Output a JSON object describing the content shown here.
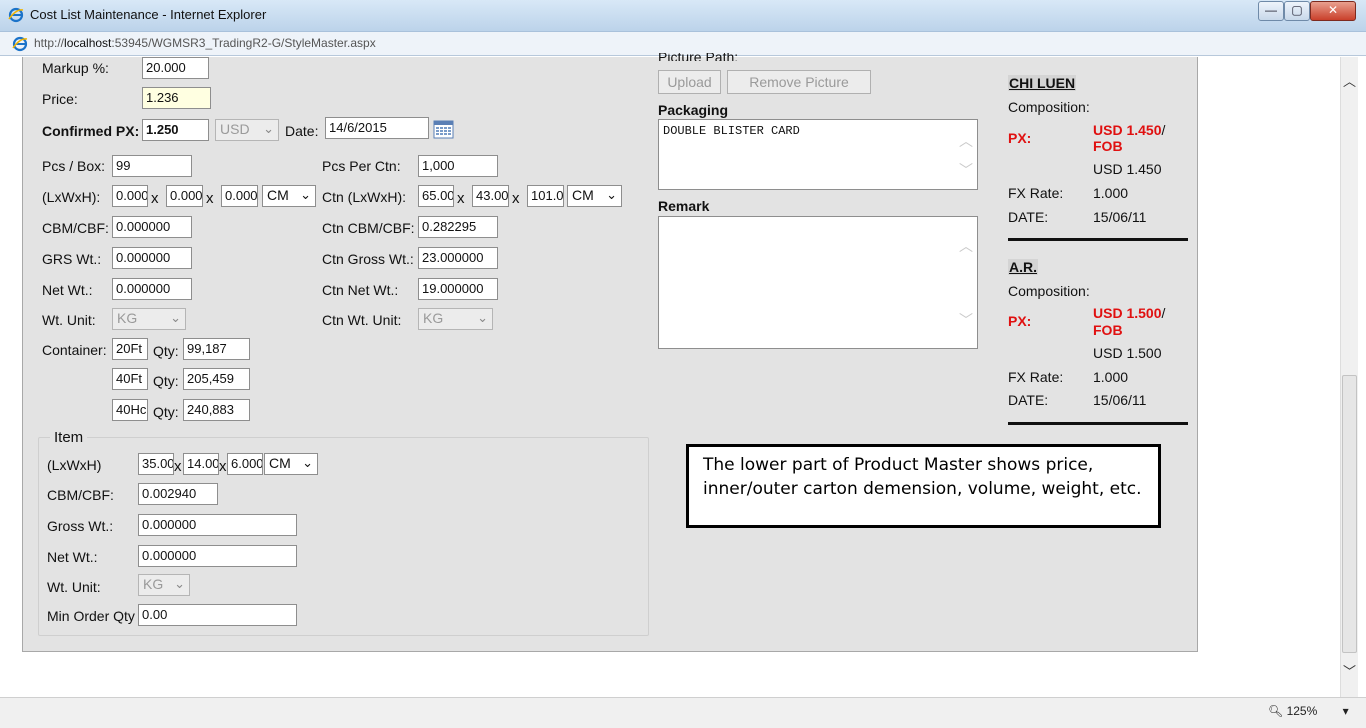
{
  "window": {
    "title": "Cost List Maintenance - Internet Explorer",
    "url_prefix": "http://",
    "url_host": "localhost",
    "url_rest": ":53945/WGMSR3_TradingR2-G/StyleMaster.aspx",
    "min": "—",
    "max": "▢",
    "close": "✕",
    "zoom": "125%"
  },
  "pricing": {
    "markup_label": "Markup %:",
    "markup_value": "20.000",
    "price_label": "Price:",
    "price_value": "1.236",
    "confirmed_px_label": "Confirmed PX:",
    "confirmed_px_value": "1.250",
    "currency": "USD",
    "date_label": "Date:",
    "date_value": "14/6/2015"
  },
  "inner": {
    "pcs_box_label": "Pcs / Box:",
    "pcs_box_value": "99",
    "lwh_label": "(LxWxH):",
    "l": "0.000",
    "w": "0.000",
    "h": "0.000",
    "unit": "CM",
    "cbm_label": "CBM/CBF:",
    "cbm_value": "0.000000",
    "grs_label": "GRS Wt.:",
    "grs_value": "0.000000",
    "net_label": "Net Wt.:",
    "net_value": "0.000000",
    "wt_unit_label": "Wt. Unit:",
    "wt_unit_value": "KG",
    "container_label": "Container:",
    "qty_label": "Qty:",
    "containers": [
      {
        "type": "20Ft",
        "qty": "99,187"
      },
      {
        "type": "40Ft",
        "qty": "205,459"
      },
      {
        "type": "40Hc",
        "qty": "240,883"
      }
    ]
  },
  "carton": {
    "pcs_ctn_label": "Pcs Per Ctn:",
    "pcs_ctn_value": "1,000",
    "lwh_label": "Ctn (LxWxH):",
    "l": "65.00",
    "w": "43.00",
    "h": "101.0",
    "unit": "CM",
    "cbm_label": "Ctn CBM/CBF:",
    "cbm_value": "0.282295",
    "gross_label": "Ctn Gross Wt.:",
    "gross_value": "23.000000",
    "net_label": "Ctn Net Wt.:",
    "net_value": "19.000000",
    "wt_unit_label": "Ctn Wt. Unit:",
    "wt_unit_value": "KG"
  },
  "item": {
    "legend": "Item",
    "lwh_label": "(LxWxH)",
    "l": "35.00",
    "w": "14.00",
    "h": "6.000",
    "unit": "CM",
    "cbm_label": "CBM/CBF:",
    "cbm_value": "0.002940",
    "gross_label": "Gross Wt.:",
    "gross_value": "0.000000",
    "net_label": "Net Wt.:",
    "net_value": "0.000000",
    "wt_unit_label": "Wt. Unit:",
    "wt_unit_value": "KG",
    "moq_label": "Min Order Qty",
    "moq_value": "0.00"
  },
  "media": {
    "picture_path_label": "Picture Path:",
    "upload": "Upload",
    "remove_picture": "Remove Picture",
    "packaging_label": "Packaging",
    "packaging_value": "DOUBLE BLISTER CARD",
    "remark_label": "Remark",
    "remark_value": ""
  },
  "suppliers": [
    {
      "name": "CHI LUEN",
      "composition_label": "Composition:",
      "px_label": "PX:",
      "px_value": "USD 1.450",
      "px_slash": "/",
      "px_terms": "FOB",
      "px_plain": "USD 1.450",
      "fx_label": "FX Rate:",
      "fx_value": "1.000",
      "date_label": "DATE:",
      "date_value": "15/06/11"
    },
    {
      "name": "A.R.",
      "composition_label": "Composition:",
      "px_label": "PX:",
      "px_value": "USD 1.500",
      "px_slash": "/",
      "px_terms": "FOB",
      "px_plain": "USD 1.500",
      "fx_label": "FX Rate:",
      "fx_value": "1.000",
      "date_label": "DATE:",
      "date_value": "15/06/11"
    }
  ],
  "callout": "The lower part of Product Master shows price, inner/outer carton demension, volume, weight, etc.",
  "colors": {
    "panel": "#e3e3e3",
    "accent_red": "#e01010",
    "price_highlight": "#ffffe1"
  }
}
